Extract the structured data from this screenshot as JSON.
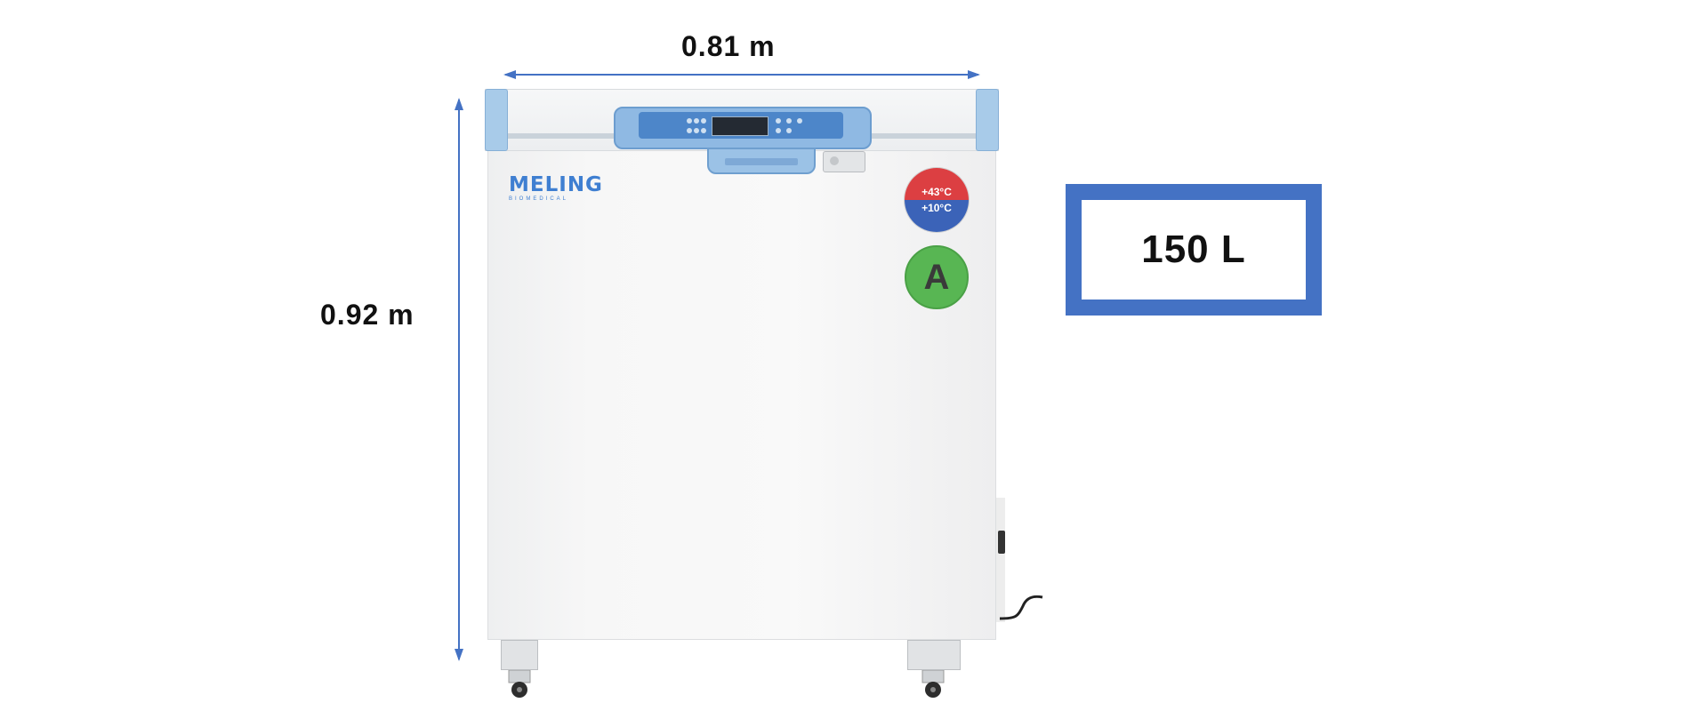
{
  "dimensions": {
    "width_label": "0.81 m",
    "height_label": "0.92 m"
  },
  "capacity": {
    "label": "150 L"
  },
  "brand": {
    "name": "MELING",
    "subtitle": "BIOMEDICAL"
  },
  "badges": {
    "temp_max": "+43°C",
    "temp_min": "+10°C",
    "energy_class": "A"
  },
  "colors": {
    "dimension_arrow": "#4472c4",
    "capacity_border": "#4472c4",
    "brand_blue": "#3f7fd1",
    "temp_hot": "#dc3f42",
    "temp_cold": "#3b63b8",
    "energy_green": "#58b653"
  },
  "icons": {
    "width_arrow": "double-headed-arrow-horizontal",
    "height_arrow": "double-headed-arrow-vertical",
    "thermometer": "thermometer-icon"
  }
}
